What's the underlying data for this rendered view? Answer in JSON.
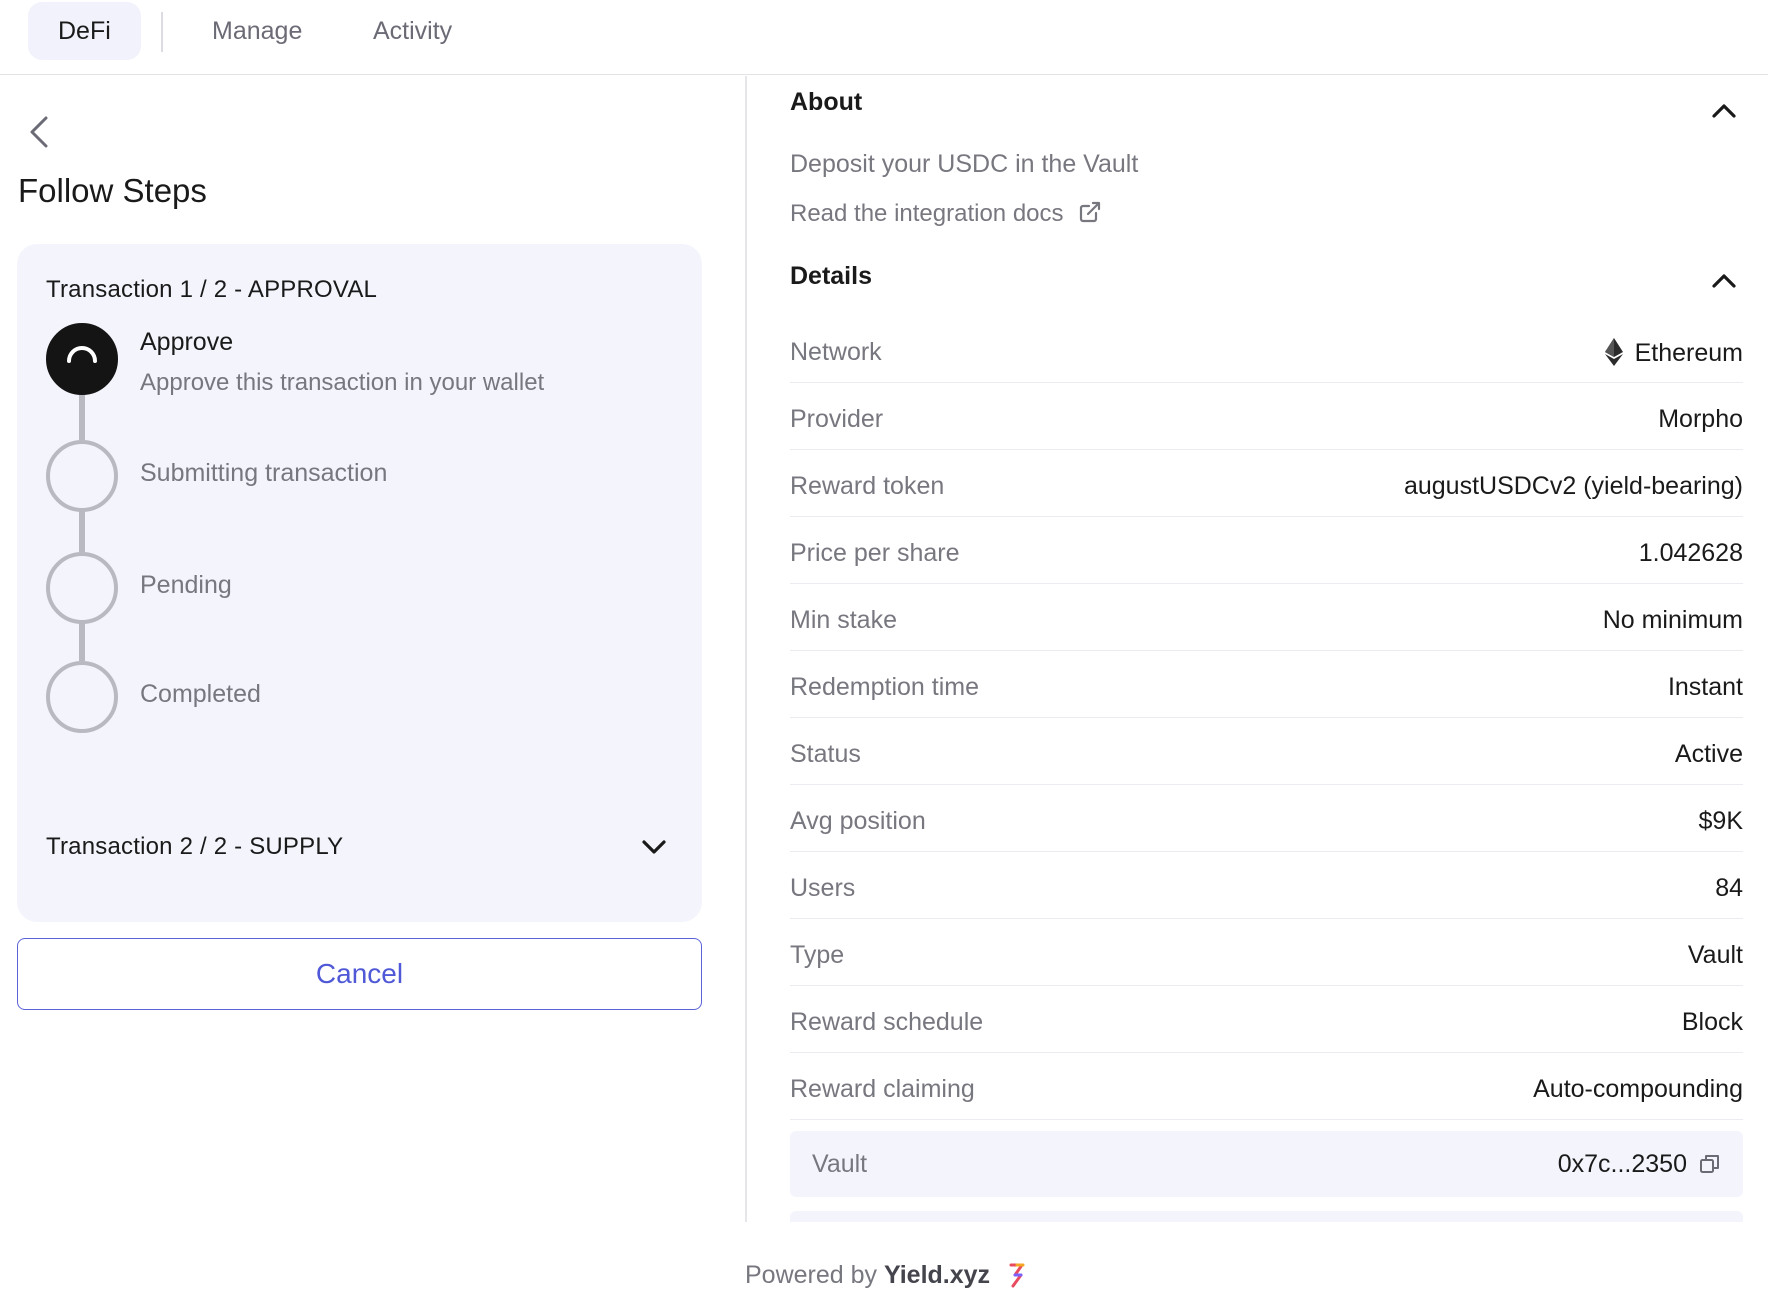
{
  "nav": {
    "tabs": [
      {
        "label": "DeFi",
        "active": true
      },
      {
        "label": "Manage",
        "active": false
      },
      {
        "label": "Activity",
        "active": false
      }
    ]
  },
  "left": {
    "title": "Follow Steps",
    "tx1_title": "Transaction 1 / 2 - APPROVAL",
    "tx2_title": "Transaction 2 / 2 - SUPPLY",
    "steps": [
      {
        "label": "Approve",
        "sub": "Approve this transaction in your wallet",
        "state": "active"
      },
      {
        "label": "Submitting transaction",
        "state": "pending"
      },
      {
        "label": "Pending",
        "state": "pending"
      },
      {
        "label": "Completed",
        "state": "pending"
      }
    ],
    "cancel_label": "Cancel"
  },
  "right": {
    "about_title": "About",
    "about_desc": "Deposit your USDC in the Vault",
    "docs_link": "Read the integration docs",
    "details_title": "Details",
    "details": [
      {
        "key": "Network",
        "value": "Ethereum"
      },
      {
        "key": "Provider",
        "value": "Morpho"
      },
      {
        "key": "Reward token",
        "value": "augustUSDCv2 (yield-bearing)"
      },
      {
        "key": "Price per share",
        "value": "1.042628"
      },
      {
        "key": "Min stake",
        "value": "No minimum"
      },
      {
        "key": "Redemption time",
        "value": "Instant"
      },
      {
        "key": "Status",
        "value": "Active"
      },
      {
        "key": "Avg position",
        "value": "$9K"
      },
      {
        "key": "Users",
        "value": "84"
      },
      {
        "key": "Type",
        "value": "Vault"
      },
      {
        "key": "Reward schedule",
        "value": "Block"
      },
      {
        "key": "Reward claiming",
        "value": "Auto-compounding"
      }
    ],
    "vault": {
      "key": "Vault",
      "value": "0x7c...2350"
    }
  },
  "footer": {
    "prefix": "Powered by",
    "brand": "Yield.xyz"
  },
  "colors": {
    "accent": "#4f58d6",
    "card_bg": "#f4f5fc",
    "muted": "#77777f"
  },
  "icons": [
    "chevron-left-icon",
    "chevron-down-icon",
    "chevron-up-icon",
    "external-link-icon",
    "ethereum-icon",
    "copy-icon",
    "yield-logo-icon"
  ]
}
